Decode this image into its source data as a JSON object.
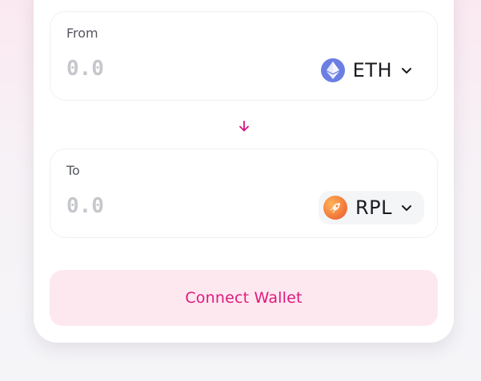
{
  "from": {
    "label": "From",
    "amount_placeholder": "0.0",
    "token": {
      "symbol": "ETH",
      "icon": "ethereum-icon",
      "color": "#6b7ee3"
    }
  },
  "swap": {
    "icon": "arrow-down-icon",
    "color": "#d4137a"
  },
  "to": {
    "label": "To",
    "amount_placeholder": "0.0",
    "token": {
      "symbol": "RPL",
      "icon": "rocket-pool-icon",
      "color": "#f27a3a"
    }
  },
  "connect_button": {
    "label": "Connect Wallet",
    "text_color": "#e0187d",
    "bg_color": "#fde8f0"
  }
}
